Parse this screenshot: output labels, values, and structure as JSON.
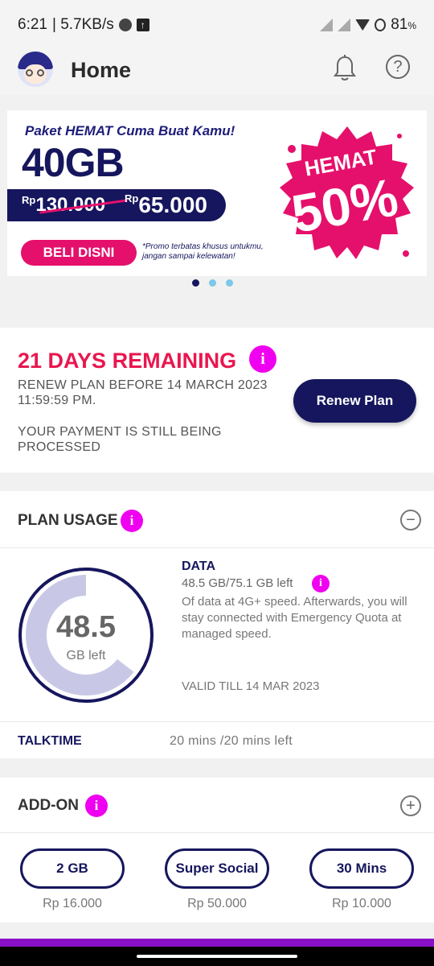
{
  "status_bar": {
    "time": "6:21",
    "speed": "| 5.7KB/s",
    "battery": "81",
    "battery_unit": "%"
  },
  "header": {
    "title": "Home"
  },
  "banner": {
    "subtitle": "Paket HEMAT Cuma Buat Kamu!",
    "quota": "40GB",
    "old_price_prefix": "Rp",
    "old_price": "130.000",
    "new_price_prefix": "Rp",
    "new_price": "65.000",
    "cta": "BELI DISNI",
    "note": "*Promo terbatas khusus untukmu, jangan sampai kelewatan!",
    "badge_top": "HEMAT",
    "badge_value": "50%",
    "pages": 3,
    "active_page": 1
  },
  "remaining": {
    "title": "21 DAYS REMAINING",
    "renew_text": "RENEW PLAN BEFORE 14 MARCH 2023 11:59:59 PM.",
    "payment_text": "YOUR PAYMENT IS STILL BEING PROCESSED",
    "renew_button": "Renew Plan"
  },
  "plan_usage": {
    "title": "PLAN USAGE",
    "gauge_value": "48.5",
    "gauge_unit": "GB left",
    "data_label": "DATA",
    "data_left": "48.5 GB/75.1 GB left",
    "data_desc": "Of data at 4G+ speed. Afterwards, you will stay connected with Emergency Quota at managed speed.",
    "valid_till": "VALID TILL 14 MAR 2023",
    "talktime_label": "TALKTIME",
    "talktime_value": "20 mins /20 mins  left",
    "used_fraction": 0.354
  },
  "addon": {
    "title": "ADD-ON",
    "items": [
      {
        "label": "2 GB",
        "price": "Rp 16.000"
      },
      {
        "label": "Super Social",
        "price": "Rp 50.000"
      },
      {
        "label": "30 Mins",
        "price": "Rp 10.000"
      }
    ]
  },
  "icons": {
    "info": "i",
    "help": "?",
    "collapse": "−",
    "expand": "+"
  },
  "colors": {
    "brand_navy": "#16165e",
    "accent_pink": "#e5106b",
    "alert_red": "#e8174e",
    "info_magenta": "#f000f0",
    "bottom_bar": "#8a10c8"
  }
}
